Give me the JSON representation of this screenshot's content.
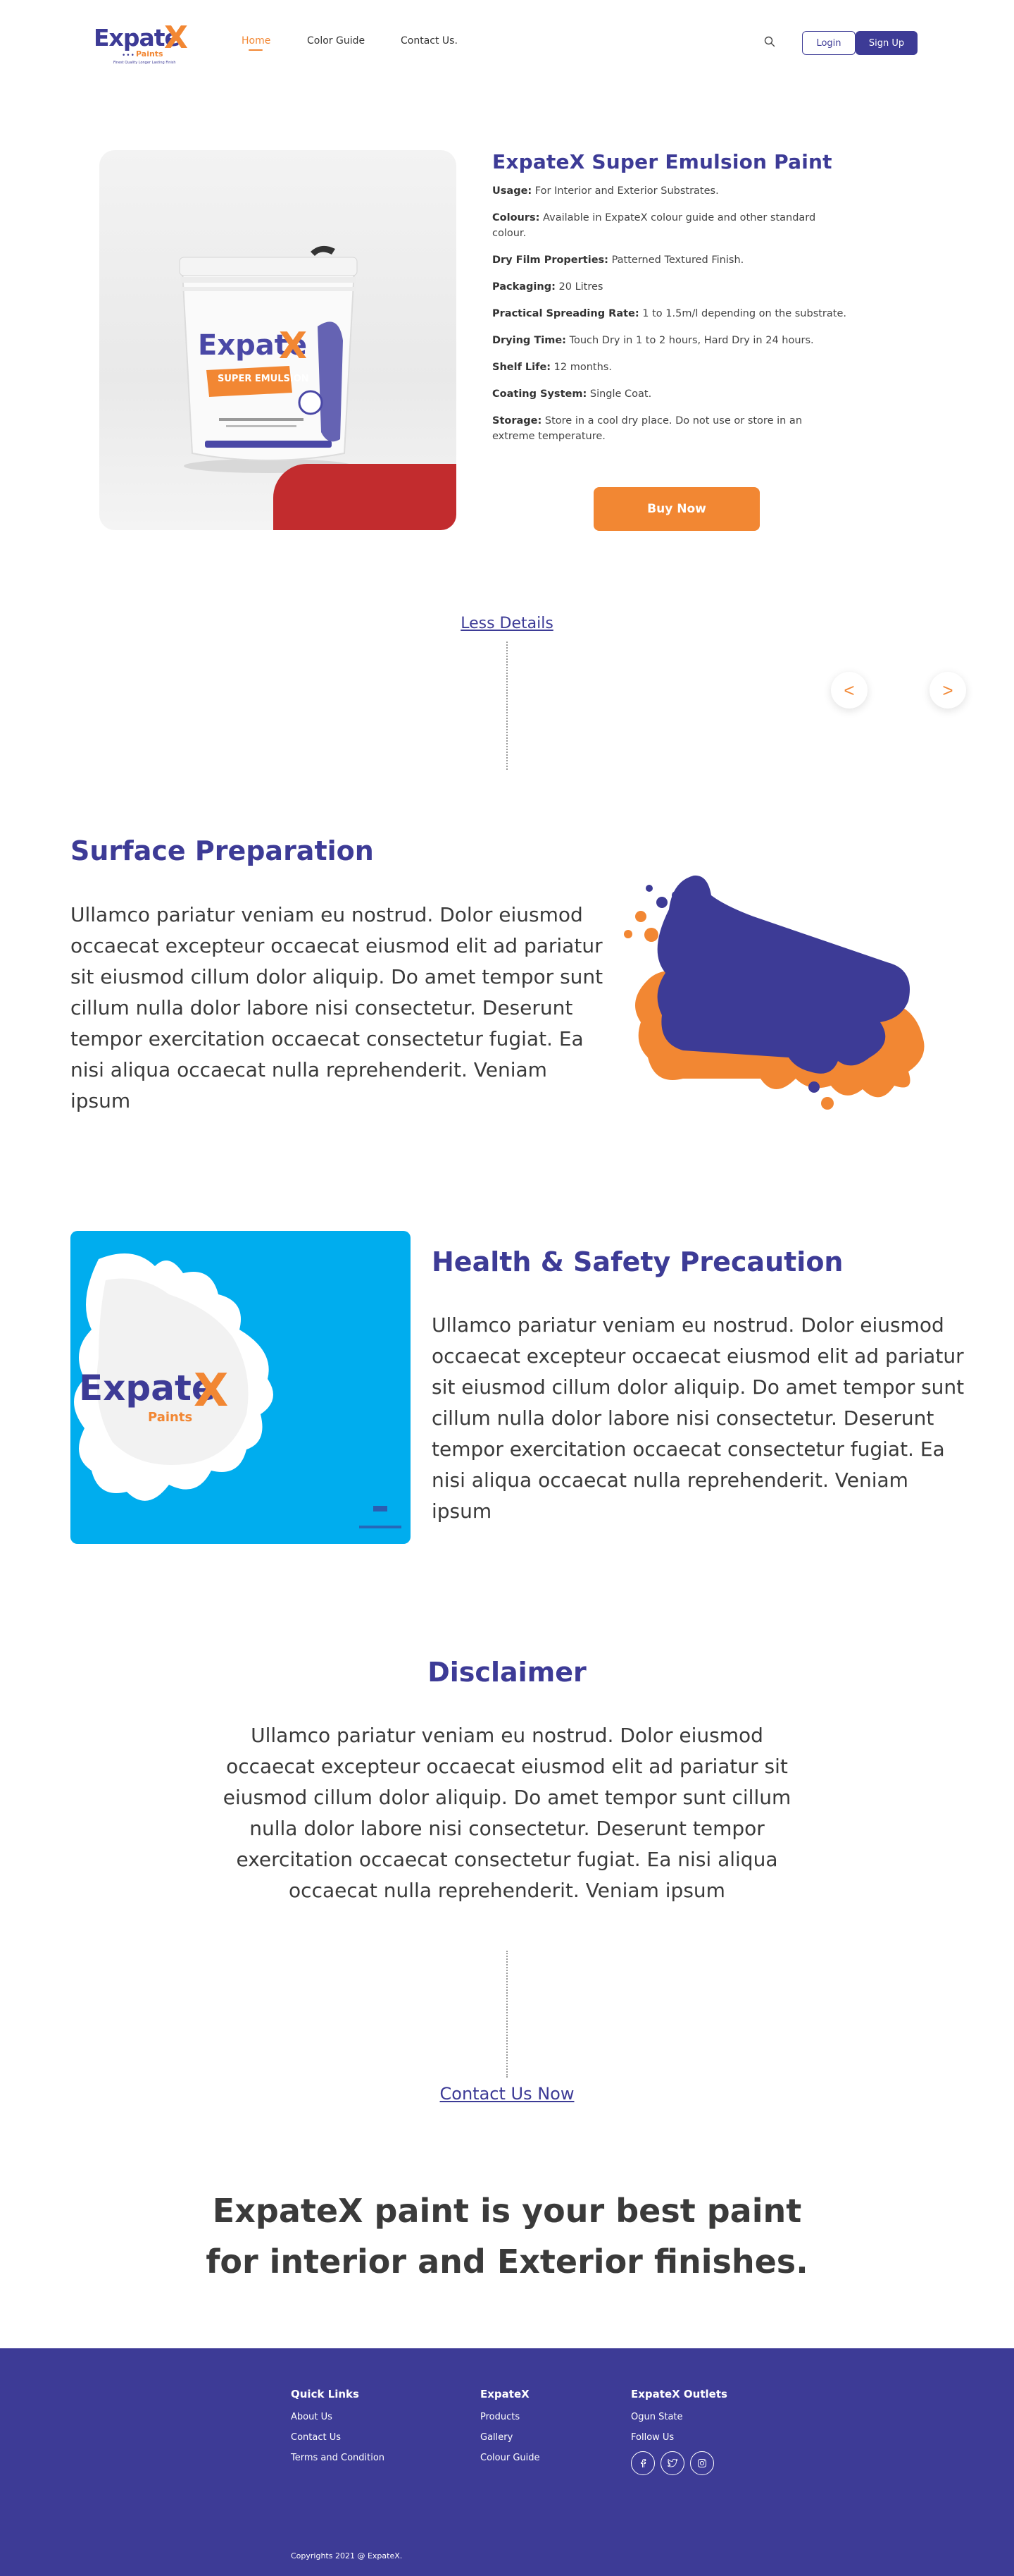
{
  "brand": {
    "name": "Expate",
    "mark": "X",
    "sub": "Paints",
    "dots": "•••",
    "tagline": "Finest Quality Longer Lasting Finish"
  },
  "nav": {
    "home": "Home",
    "color_guide": "Color Guide",
    "contact": "Contact Us."
  },
  "auth": {
    "login": "Login",
    "signup": "Sign Up"
  },
  "product": {
    "title": "ExpateX Super Emulsion Paint",
    "bucket_brand": "Expate",
    "bucket_label": "SUPER EMULSION",
    "specs": [
      {
        "label": "Usage:",
        "value": " For Interior and Exterior Substrates."
      },
      {
        "label": "Colours:",
        "value": "  Available in ExpateX colour guide and other standard colour."
      },
      {
        "label": "Dry Film Properties:",
        "value": "  Patterned Textured Finish."
      },
      {
        "label": "Packaging:",
        "value": "  20 Litres"
      },
      {
        "label": "Practical Spreading Rate:",
        "value": "  1 to 1.5m/l depending on the substrate."
      },
      {
        "label": "Drying Time:",
        "value": "  Touch Dry in 1 to 2 hours, Hard Dry in 24 hours."
      },
      {
        "label": "Shelf Life:",
        "value": " 12 months."
      },
      {
        "label": "Coating System:",
        "value": " Single Coat."
      },
      {
        "label": "Storage:",
        "value": " Store in a cool dry place. Do not use or store in an extreme temperature."
      }
    ],
    "buy_label": "Buy Now"
  },
  "less_details": "Less Details",
  "arrows": {
    "prev": "<",
    "next": ">"
  },
  "surface": {
    "title": "Surface Preparation",
    "text": "Ullamco pariatur veniam eu nostrud. Dolor eiusmod occaecat excepteur occaecat eiusmod elit ad pariatur sit eiusmod cillum dolor aliquip. Do amet tempor sunt cillum nulla dolor labore nisi consectetur. Deserunt tempor exercitation occaecat consectetur fugiat. Ea nisi aliqua occaecat nulla reprehenderit. Veniam ipsum"
  },
  "health": {
    "title": "Health & Safety Precaution",
    "text": "Ullamco pariatur veniam eu nostrud. Dolor eiusmod occaecat excepteur occaecat eiusmod elit ad pariatur sit eiusmod cillum dolor aliquip. Do amet tempor sunt cillum nulla dolor labore nisi consectetur. Deserunt tempor exercitation occaecat consectetur fugiat. Ea nisi aliqua occaecat nulla reprehenderit. Veniam ipsum"
  },
  "disclaimer": {
    "title": "Disclaimer",
    "text": "Ullamco pariatur veniam eu nostrud. Dolor eiusmod occaecat excepteur occaecat eiusmod elit ad pariatur sit eiusmod cillum dolor aliquip. Do amet tempor sunt cillum nulla dolor labore nisi consectetur. Deserunt tempor exercitation occaecat consectetur fugiat. Ea nisi aliqua occaecat nulla reprehenderit. Veniam ipsum"
  },
  "contact_now": "Contact Us Now",
  "tagline": "ExpateX paint is your best paint for interior and Exterior finishes.",
  "footer": {
    "quick_links": {
      "title": "Quick Links",
      "items": [
        "About Us",
        "Contact Us",
        "Terms and Condition"
      ]
    },
    "expatex": {
      "title": "ExpateX",
      "items": [
        "Products",
        "Gallery",
        "Colour Guide"
      ]
    },
    "outlets": {
      "title": "ExpateX Outlets",
      "items": [
        "Ogun State",
        "Follow Us"
      ]
    },
    "socials": [
      "facebook-icon",
      "twitter-icon",
      "instagram-icon"
    ],
    "copyright": "Copyrights 2021 @ ExpateX."
  },
  "colors": {
    "brand_blue": "#3d3b96",
    "brand_orange": "#f28733",
    "accent_red": "#c22c2e",
    "sky_blue": "#00adee"
  }
}
